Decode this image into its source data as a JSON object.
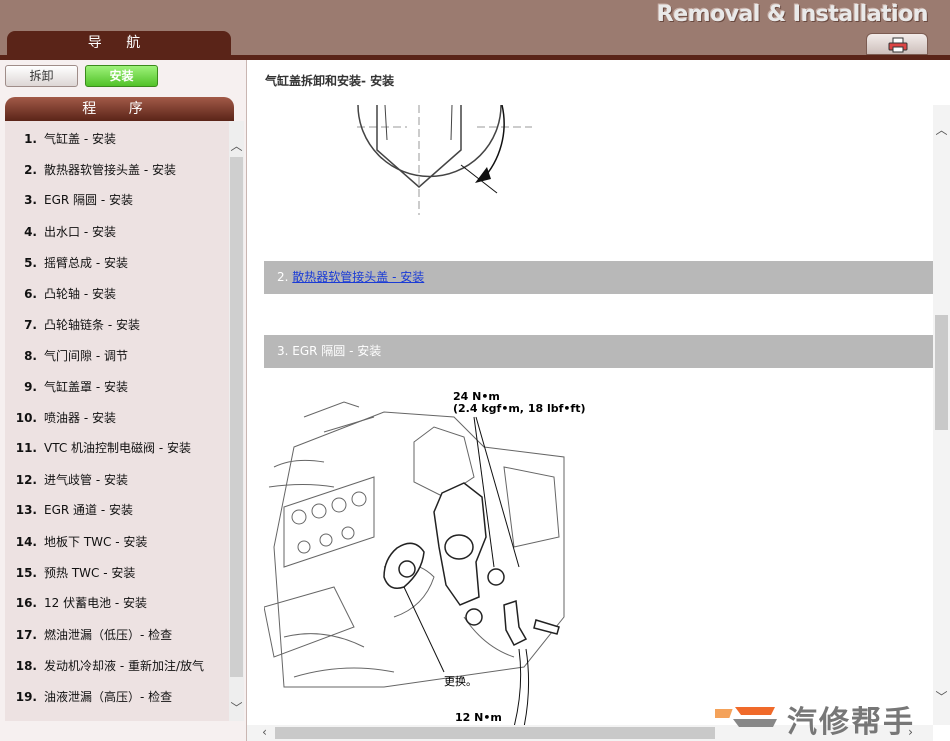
{
  "header": {
    "title": "Removal & Installation",
    "print_icon": "printer-icon"
  },
  "nav_tab": {
    "label": "导 航"
  },
  "mode_buttons": {
    "remove": "拆卸",
    "install": "安装"
  },
  "procedure": {
    "header": "程 序",
    "items": [
      {
        "num": "1.",
        "label": "气缸盖 - 安装"
      },
      {
        "num": "2.",
        "label": "散热器软管接头盖 - 安装"
      },
      {
        "num": "3.",
        "label": "EGR 隔圆 - 安装"
      },
      {
        "num": "4.",
        "label": "出水口 - 安装"
      },
      {
        "num": "5.",
        "label": "摇臂总成 - 安装"
      },
      {
        "num": "6.",
        "label": "凸轮轴 - 安装"
      },
      {
        "num": "7.",
        "label": "凸轮轴链条 - 安装"
      },
      {
        "num": "8.",
        "label": "气门间隙 - 调节"
      },
      {
        "num": "9.",
        "label": "气缸盖罩 - 安装"
      },
      {
        "num": "10.",
        "label": "喷油器 - 安装"
      },
      {
        "num": "11.",
        "label": "VTC 机油控制电磁阀 - 安装"
      },
      {
        "num": "12.",
        "label": "进气歧管 - 安装"
      },
      {
        "num": "13.",
        "label": "EGR 通道 - 安装"
      },
      {
        "num": "14.",
        "label": "地板下 TWC - 安装"
      },
      {
        "num": "15.",
        "label": "预热 TWC - 安装"
      },
      {
        "num": "16.",
        "label": "12 伏蓄电池 - 安装"
      },
      {
        "num": "17.",
        "label": "燃油泄漏（低压）- 检查"
      },
      {
        "num": "18.",
        "label": "发动机冷却液 - 重新加注/放气"
      },
      {
        "num": "19.",
        "label": "油液泄漏（高压）- 检查"
      }
    ]
  },
  "content": {
    "title": "气缸盖拆卸和安装- 安装",
    "section2": {
      "num": "2.",
      "link": "散热器软管接头盖 - 安装"
    },
    "section3": {
      "label": "3. EGR 隔圆 - 安装"
    },
    "diagram": {
      "torque1_value": "24 N•m",
      "torque1_detail": "(2.4 kgf•m, 18 lbf•ft)",
      "replace_note": "更换。",
      "torque2_value": "12 N•m"
    }
  },
  "watermark": {
    "text": "汽修帮手"
  }
}
